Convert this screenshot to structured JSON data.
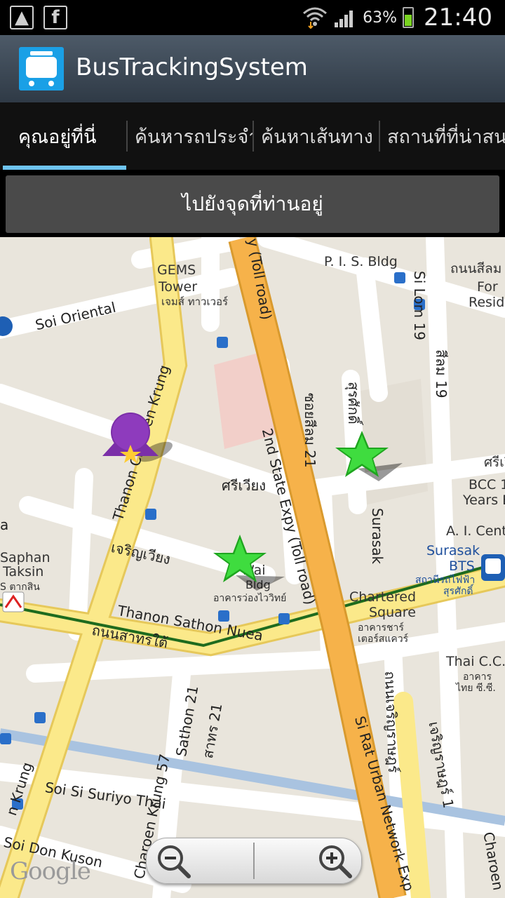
{
  "status_bar": {
    "battery_percent": "63%",
    "time": "21:40"
  },
  "app": {
    "title": "BusTrackingSystem"
  },
  "tabs": [
    {
      "label": "คุณอยู่ที่นี่",
      "selected": true
    },
    {
      "label": "ค้นหารถประจำทาง",
      "selected": false
    },
    {
      "label": "ค้นหาเส้นทาง",
      "selected": false
    },
    {
      "label": "สถานที่ที่น่าสนใจ",
      "selected": false
    }
  ],
  "go_button": {
    "label": "ไปยังจุดที่ท่านอยู่"
  },
  "map": {
    "labels": {
      "gems": "GEMS",
      "tower": "Tower",
      "gems_th": "เจมส์ ทาวเวอร์",
      "pis": "P. I. S. Bldg",
      "thanon_silom": "ถนนสีลม",
      "for": "For",
      "resid": "Resid",
      "soi_oriental": "Soi Oriental",
      "si_lom_19": "Si Lom 19",
      "silom_19_th": "สีลม 19",
      "toll_top": "y (Toll road)",
      "toll_mid": "2nd State Expy (Toll road)",
      "soi_silom_21": "ซอยสีลม 21",
      "surasak_th": "สุรศักดิ์",
      "charoen_krung_top": "Thanon Charoen Krung",
      "siwiang": "ศรีเวียง",
      "sri_right": "ศรีเวี",
      "bcc": "BCC 1",
      "years": "Years B",
      "ai_cent": "A. I. Cent",
      "surasak": "Surasak",
      "surasak_bts": "Surasak",
      "bts": "BTS",
      "bts_th": "สถานีรถไฟฟ้า",
      "surasak_th2": "สุรศักดิ์",
      "charoen_wiang": "เจริญเวียง",
      "saphan": "Saphan",
      "taksin": "Taksin",
      "taksin_th": "S ตากสิน",
      "wai": "Wai",
      "bldg": "Bldg",
      "wong_wai_th": "อาคารว่องไววิทย์",
      "chartered": "Chartered",
      "square": "Square",
      "chartered_th": "อาคารชาร์",
      "chartered_th2": "เตอร์สแควร์",
      "sathon_nuea": "Thanon Sathon Nuea",
      "sathon_tai": "ถนนสาทรใต้",
      "thai_cc": "Thai C.C.",
      "thai_cc_th": "อาคาร",
      "thai_cc_th2": "ไทย ซี.ซี.",
      "sathon_21": "Sathon 21",
      "sathon_21_th": "สาทร 21",
      "charoen_rat_th": "ถนนเจริญราษฎร์",
      "charoen_rat_1": "เจริญราษฎร์ 1",
      "si_rat": "Si Rat Urban Network Exp",
      "soi_si_suriyo": "Soi Si Suriyo Thai",
      "charoen_krung_57": "Charoen Krung 57",
      "soi_don_kuson": "Soi Don Kuson",
      "charoen_bottom": "Charoen",
      "krung_left": "n Krung",
      "krung_left2": "Thanon",
      "a_left": "a",
      "google": "Google"
    },
    "markers": [
      {
        "type": "user-location",
        "color": "#7b2fa8"
      },
      {
        "type": "bus-stop-star",
        "color": "#2ecb2e"
      },
      {
        "type": "bus-stop-star",
        "color": "#2ecb2e"
      }
    ],
    "colors": {
      "expressway": "#f6b24a",
      "main_road": "#fbe98a",
      "bts_line": "#1e6b1e",
      "canal": "#a9c3e0"
    }
  }
}
